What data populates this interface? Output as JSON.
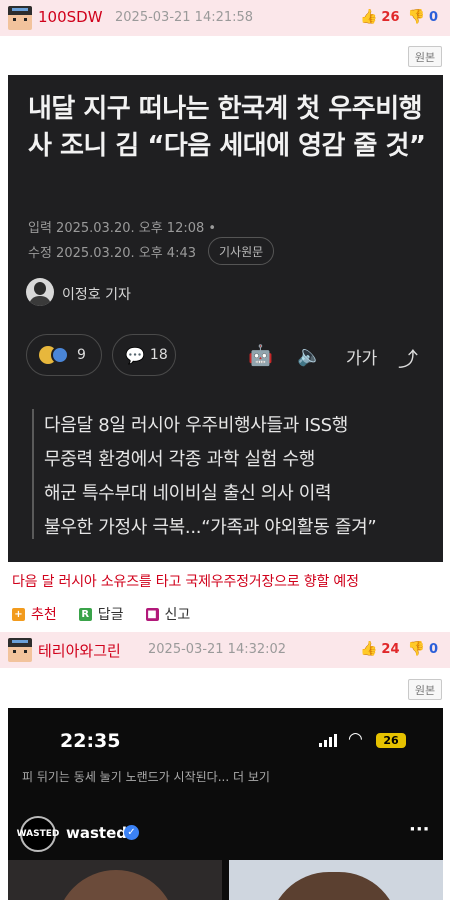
{
  "comments": [
    {
      "nickname": "100SDW",
      "timestamp": "2025-03-21 14:21:58",
      "upvotes": "26",
      "downvotes": "0",
      "original_label": "원본",
      "article": {
        "title": "내달 지구 떠나는 한국계 첫 우주비행사 조니 김 “다음 세대에 영감 줄 것”",
        "published": "입력 2025.03.20. 오후 12:08 •",
        "modified": "수정 2025.03.20. 오후 4:43",
        "source_button": "기사원문",
        "reporter": "이정호 기자",
        "reactions_count": "9",
        "comments_count": "18",
        "font_size_label": "가가",
        "bullets": [
          "다음달 8일 러시아 우주비행사들과 ISS행",
          "무중력 환경에서 각종 과학 실험 수행",
          "해군 특수부대 네이비실 출신 의사 이력",
          "불우한 가정사 극복...“가족과 야외활동 즐겨”"
        ]
      },
      "caption": "다음 달 러시아 소유즈를 타고 국제우주정거장으로 향할 예정",
      "actions": {
        "recommend": "추천",
        "reply": "답글",
        "report": "신고"
      }
    },
    {
      "nickname": "테리아와그린",
      "timestamp": "2025-03-21 14:32:02",
      "upvotes": "24",
      "downvotes": "0",
      "original_label": "원본",
      "phone": {
        "time": "22:35",
        "battery": "26",
        "cut_text": "피 뒤기는 동세 눌기 노랜드가 시작된다... 더 보기",
        "logo_text": "WASTED",
        "account": "wasted"
      }
    }
  ],
  "colors": {
    "header_bg": "#fbe7ea",
    "nickname": "#d0011b",
    "upvote": "#e0282a",
    "downvote": "#2b5fd9",
    "article_bg": "#1f1f21"
  },
  "icons": [
    "thumbs-up-icon",
    "thumbs-down-icon",
    "robot-icon",
    "speaker-icon",
    "share-icon",
    "comment-bubble-icon",
    "verified-icon",
    "more-dots-icon"
  ]
}
